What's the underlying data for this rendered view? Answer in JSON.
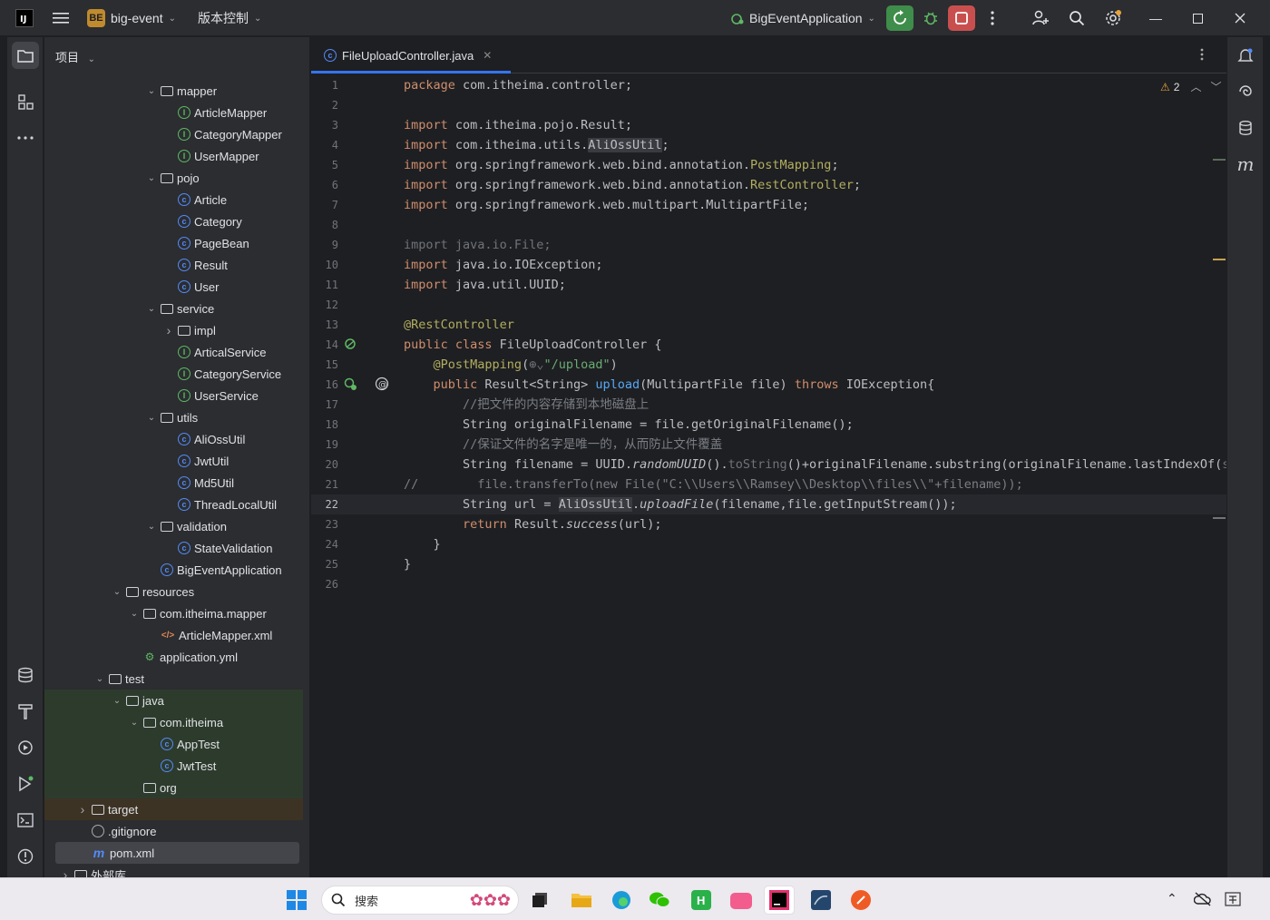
{
  "titlebar": {
    "project_badge": "BE",
    "project_name": "big-event",
    "vcs": "版本控制",
    "run_config": "BigEventApplication"
  },
  "project_panel": {
    "title": "项目",
    "tree": [
      {
        "label": "mapper",
        "icon": "package-folder",
        "arrow": "v",
        "indent": 0
      },
      {
        "label": "ArticleMapper",
        "icon": "interface",
        "indent": 1
      },
      {
        "label": "CategoryMapper",
        "icon": "interface",
        "indent": 1
      },
      {
        "label": "UserMapper",
        "icon": "interface",
        "indent": 1
      },
      {
        "label": "pojo",
        "icon": "package-folder",
        "arrow": "v",
        "indent": 0
      },
      {
        "label": "Article",
        "icon": "class",
        "indent": 1
      },
      {
        "label": "Category",
        "icon": "class",
        "indent": 1
      },
      {
        "label": "PageBean",
        "icon": "class",
        "indent": 1
      },
      {
        "label": "Result",
        "icon": "class",
        "indent": 1
      },
      {
        "label": "User",
        "icon": "class",
        "indent": 1
      },
      {
        "label": "service",
        "icon": "package-folder",
        "arrow": "v",
        "indent": 0
      },
      {
        "label": "impl",
        "icon": "package-folder",
        "arrow": ">",
        "indent": 1
      },
      {
        "label": "ArticalService",
        "icon": "interface",
        "indent": 1
      },
      {
        "label": "CategoryService",
        "icon": "interface",
        "indent": 1
      },
      {
        "label": "UserService",
        "icon": "interface",
        "indent": 1
      },
      {
        "label": "utils",
        "icon": "package-folder",
        "arrow": "v",
        "indent": 0
      },
      {
        "label": "AliOssUtil",
        "icon": "class",
        "indent": 1
      },
      {
        "label": "JwtUtil",
        "icon": "class",
        "indent": 1
      },
      {
        "label": "Md5Util",
        "icon": "class",
        "indent": 1
      },
      {
        "label": "ThreadLocalUtil",
        "icon": "class",
        "indent": 1
      },
      {
        "label": "validation",
        "icon": "package-folder",
        "arrow": "v",
        "indent": 0
      },
      {
        "label": "StateValidation",
        "icon": "class",
        "indent": 1
      },
      {
        "label": "BigEventApplication",
        "icon": "class",
        "indent": 0
      },
      {
        "label": "resources",
        "icon": "folder",
        "arrow": "v",
        "indent": -2
      },
      {
        "label": "com.itheima.mapper",
        "icon": "folder",
        "arrow": "v",
        "indent": -1
      },
      {
        "label": "ArticleMapper.xml",
        "icon": "xml",
        "indent": 0
      },
      {
        "label": "application.yml",
        "icon": "yml",
        "indent": -1
      },
      {
        "label": "test",
        "icon": "folder",
        "arrow": "v",
        "indent": -3
      },
      {
        "label": "java",
        "icon": "folder",
        "arrow": "v",
        "indent": -2,
        "bg": "green"
      },
      {
        "label": "com.itheima",
        "icon": "package-folder",
        "arrow": "v",
        "indent": -1,
        "bg": "green"
      },
      {
        "label": "AppTest",
        "icon": "class",
        "indent": 0,
        "bg": "green"
      },
      {
        "label": "JwtTest",
        "icon": "class",
        "indent": 0,
        "bg": "green"
      },
      {
        "label": "org",
        "icon": "package-folder",
        "indent": -1,
        "bg": "green"
      },
      {
        "label": "target",
        "icon": "folder",
        "arrow": ">",
        "indent": -4,
        "bg": "brown"
      },
      {
        "label": ".gitignore",
        "icon": "ignore",
        "indent": -4
      },
      {
        "label": "pom.xml",
        "icon": "maven",
        "indent": -4,
        "bg": "sel"
      },
      {
        "label": "外部库",
        "icon": "library",
        "arrow": ">",
        "indent": -5
      }
    ]
  },
  "editor": {
    "tab_label": "FileUploadController.java",
    "warnings": "2",
    "lines": [
      "<span class=\"kw\">package</span> com.itheima.controller;",
      "",
      "<span class=\"kw\">import</span> com.itheima.pojo.Result;",
      "<span class=\"kw\">import</span> com.itheima.utils.<span class=\"hi\">AliOssUtil</span>;",
      "<span class=\"kw\">import</span> org.springframework.web.bind.annotation.<span class=\"an\">PostMapping</span>;",
      "<span class=\"kw\">import</span> org.springframework.web.bind.annotation.<span class=\"an\">RestController</span>;",
      "<span class=\"kw\">import</span> org.springframework.web.multipart.MultipartFile;",
      "",
      "<span class=\"grey\">import java.io.File;</span>",
      "<span class=\"kw\">import</span> java.io.IOException;",
      "<span class=\"kw\">import</span> java.util.UUID;",
      "",
      "<span class=\"an\">@RestController</span>",
      "<span class=\"kw\">public class</span> FileUploadController {",
      "    <span class=\"an\">@PostMapping</span>(<span class=\"grey\">⊕⌄</span><span class=\"str\">\"/upload\"</span>)",
      "    <span class=\"kw\">public</span> Result&lt;String&gt; <span class=\"fn\">upload</span>(MultipartFile file) <span class=\"kw\">throws</span> IOException{",
      "        <span class=\"cm\">//把文件的内容存储到本地磁盘上</span>",
      "        String originalFilename = file.getOriginalFilename();",
      "        <span class=\"cm\">//保证文件的名字是唯一的，从而防止文件覆盖</span>",
      "        String filename = UUID.<span class=\"it\">randomUUID</span>().<span class=\"grey\">toString</span>()+originalFilename.substring(originalFilename.lastIndexOf(<span class=\"grey\">st</span>",
      "<span class=\"cm\">//        file.transferTo(new File(\"C:\\\\Users\\\\Ramsey\\\\Desktop\\\\files\\\\\"+filename));</span>",
      "        String url = <span class=\"hi\">AliOssUtil</span>.<span class=\"it\">uploadFile</span>(filename,file.getInputStream());",
      "        <span class=\"kw\">return</span> Result.<span class=\"it\">success</span>(url);",
      "    }",
      "}",
      ""
    ]
  },
  "taskbar": {
    "search_placeholder": "搜索"
  }
}
